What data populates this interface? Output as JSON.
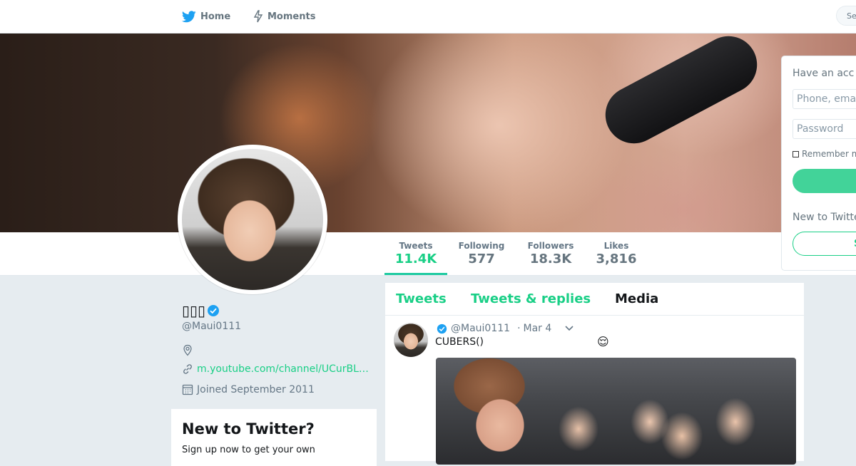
{
  "topbar": {
    "home_label": "Home",
    "moments_label": "Moments",
    "search_placeholder": "Se",
    "have_account_short": "Ha"
  },
  "profile": {
    "name": "▯▯▯",
    "handle": "@Maui0111",
    "location": "",
    "website": "m.youtube.com/channel/UCurBL…",
    "joined": "Joined September 2011"
  },
  "stats": [
    {
      "label": "Tweets",
      "value": "11.4K"
    },
    {
      "label": "Following",
      "value": "577"
    },
    {
      "label": "Followers",
      "value": "18.3K"
    },
    {
      "label": "Likes",
      "value": "3,816"
    }
  ],
  "timeline_tabs": [
    {
      "label": "Tweets"
    },
    {
      "label": "Tweets & replies"
    },
    {
      "label": "Media"
    }
  ],
  "tweet": {
    "handle": "@Maui0111",
    "date": "Mar 4",
    "dot": "·",
    "text": "CUBERS()",
    "emoji": "😌"
  },
  "login": {
    "title": "Have an acc",
    "phone_placeholder": "Phone, emai",
    "password_placeholder": "Password",
    "remember": "Remember m",
    "new_to_twitter": "New to Twitte",
    "signup_label": "S"
  },
  "new_to_twitter_card": {
    "title": "New to Twitter?",
    "subtitle": "Sign up now to get your own"
  },
  "colors": {
    "accent": "#19cf86",
    "verified": "#1da1f2",
    "twitter_bird": "#1da1f2"
  }
}
